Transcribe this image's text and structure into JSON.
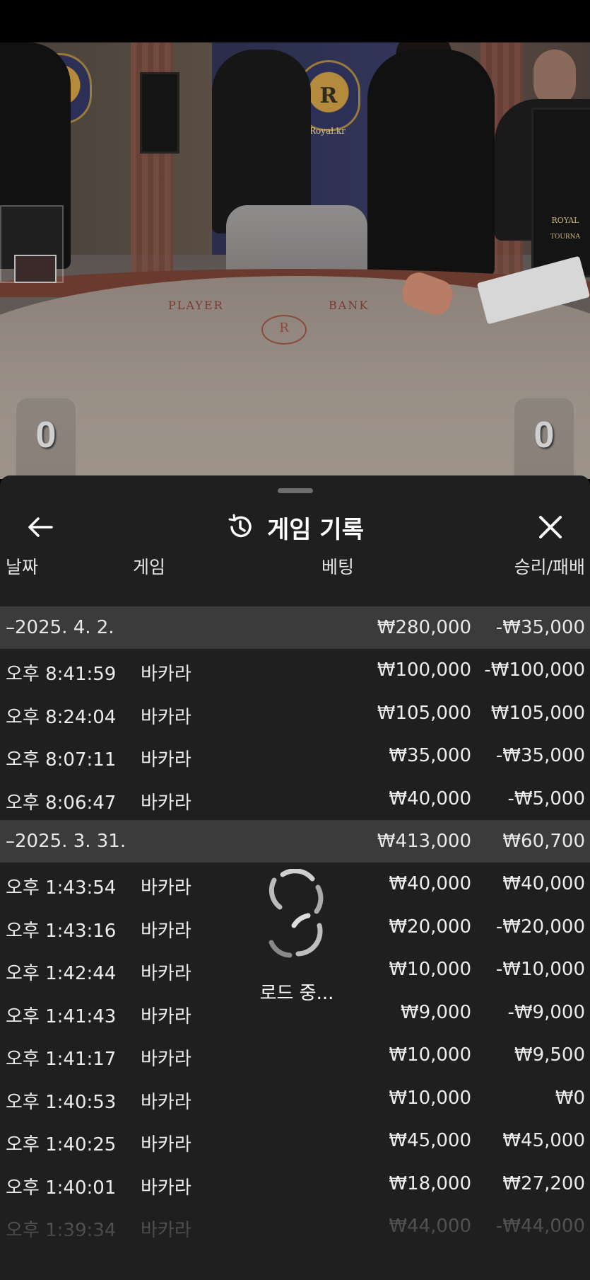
{
  "scene": {
    "crest_letter": "R",
    "crest_label": "Royal.kr",
    "felt_player": "PLAYER",
    "felt_banker": "BANK",
    "felt_logo_letter": "R",
    "monitor_text_right": "ROYAL",
    "monitor_text_right_sub": "TOURNA",
    "player_score": "0",
    "banker_score": "0"
  },
  "header": {
    "title": "게임 기록",
    "back_icon": "arrow-left-icon",
    "history_icon": "history-icon",
    "close_icon": "close-icon"
  },
  "columns": {
    "date": "날짜",
    "game": "게임",
    "bet": "베팅",
    "win_loss": "승리/패배"
  },
  "groups": [
    {
      "date": "–2025. 4. 2.",
      "bet_total": "₩280,000",
      "win_total": "-₩35,000",
      "rows": [
        {
          "time": "오후 8:41:59",
          "game": "바카라",
          "bet": "₩100,000",
          "win": "-₩100,000"
        },
        {
          "time": "오후 8:24:04",
          "game": "바카라",
          "bet": "₩105,000",
          "win": "₩105,000"
        },
        {
          "time": "오후 8:07:11",
          "game": "바카라",
          "bet": "₩35,000",
          "win": "-₩35,000"
        },
        {
          "time": "오후 8:06:47",
          "game": "바카라",
          "bet": "₩40,000",
          "win": "-₩5,000"
        }
      ]
    },
    {
      "date": "–2025. 3. 31.",
      "bet_total": "₩413,000",
      "win_total": "₩60,700",
      "rows": [
        {
          "time": "오후 1:43:54",
          "game": "바카라",
          "bet": "₩40,000",
          "win": "₩40,000"
        },
        {
          "time": "오후 1:43:16",
          "game": "바카라",
          "bet": "₩20,000",
          "win": "-₩20,000"
        },
        {
          "time": "오후 1:42:44",
          "game": "바카라",
          "bet": "₩10,000",
          "win": "-₩10,000"
        },
        {
          "time": "오후 1:41:43",
          "game": "바카라",
          "bet": "₩9,000",
          "win": "-₩9,000"
        },
        {
          "time": "오후 1:41:17",
          "game": "바카라",
          "bet": "₩10,000",
          "win": "₩9,500"
        },
        {
          "time": "오후 1:40:53",
          "game": "바카라",
          "bet": "₩10,000",
          "win": "₩0"
        },
        {
          "time": "오후 1:40:25",
          "game": "바카라",
          "bet": "₩45,000",
          "win": "₩45,000"
        },
        {
          "time": "오후 1:40:01",
          "game": "바카라",
          "bet": "₩18,000",
          "win": "₩27,200"
        },
        {
          "time": "오후 1:39:34",
          "game": "바카라",
          "bet": "₩44,000",
          "win": "-₩44,000"
        }
      ]
    }
  ],
  "loading": {
    "text": "로드 중...",
    "icon": "spinner-icon"
  }
}
